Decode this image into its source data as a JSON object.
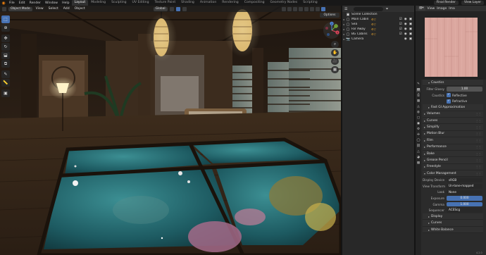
{
  "topbar": {
    "menus": [
      "File",
      "Edit",
      "Render",
      "Window",
      "Help"
    ],
    "workspaces": [
      "Layout",
      "Modeling",
      "Sculpting",
      "UV Editing",
      "Texture Paint",
      "Shading",
      "Animation",
      "Rendering",
      "Compositing",
      "Geometry Nodes",
      "Scripting"
    ],
    "active_workspace": "Layout",
    "scene": "Final Render",
    "view_layer": "View Layer"
  },
  "viewport": {
    "mode": "Object Mode",
    "menus": [
      "View",
      "Select",
      "Add",
      "Object"
    ],
    "transform_orientation": "Global",
    "options_label": "Options",
    "tools": [
      {
        "icon": "select-cursor-icon",
        "glyph": "⬚"
      },
      {
        "icon": "cursor-icon",
        "glyph": "⊕"
      },
      {
        "icon": "move-icon",
        "glyph": "✥"
      },
      {
        "icon": "rotate-icon",
        "glyph": "↻"
      },
      {
        "icon": "scale-icon",
        "glyph": "⬓"
      },
      {
        "icon": "transform-icon",
        "glyph": "⧉"
      },
      {
        "icon": "annotate-icon",
        "glyph": "✎"
      },
      {
        "icon": "measure-icon",
        "glyph": "📏"
      },
      {
        "icon": "add-cube-icon",
        "glyph": "▣"
      }
    ],
    "gizmo_axes": {
      "x": "X",
      "y": "Y",
      "z": "Z"
    },
    "nav_buttons": [
      {
        "icon": "zoom-icon",
        "glyph": "⌕"
      },
      {
        "icon": "pan-icon",
        "glyph": "✋"
      },
      {
        "icon": "camera-view-icon",
        "glyph": "🎥"
      },
      {
        "icon": "perspective-icon",
        "glyph": "▦"
      }
    ]
  },
  "outliner": {
    "root": "Scene Collection",
    "items": [
      {
        "name": "Main Cabin",
        "icon": "collection-icon"
      },
      {
        "name": "Sea",
        "icon": "collection-icon"
      },
      {
        "name": "Far Away",
        "icon": "collection-icon"
      },
      {
        "name": "BG Cabins",
        "icon": "collection-icon"
      },
      {
        "name": "Camera",
        "icon": "camera-icon"
      }
    ]
  },
  "image_editor": {
    "view": "View",
    "image": "Image",
    "menu3": "Ima"
  },
  "properties": {
    "caustics": {
      "section": "Caustics",
      "filter_glossy_label": "Filter Glossy",
      "filter_glossy_value": "1.00",
      "caustics_label": "Caustics",
      "reflective_label": "Reflective",
      "refractive_label": "Refractive"
    },
    "sections_mid": [
      "Fast GI Approximation",
      "Volumes",
      "Curves",
      "Simplify",
      "Motion Blur",
      "Film",
      "Performance",
      "Bake",
      "Grease Pencil",
      "Freestyle",
      "Color Management"
    ],
    "color_management": {
      "display_device_label": "Display Device",
      "display_device_value": "sRGB",
      "view_transform_label": "View Transform",
      "view_transform_value": "Un-tone-mapped",
      "look_label": "Look",
      "look_value": "None",
      "exposure_label": "Exposure",
      "exposure_value": "0.000",
      "gamma_label": "Gamma",
      "gamma_value": "1.000",
      "sequencer_label": "Sequencer",
      "sequencer_value": "ACEScg",
      "sub_sections": [
        "Display",
        "Curves",
        "White Balance"
      ]
    }
  },
  "status": {
    "version": "4.2.0"
  },
  "colors": {
    "accent": "#4772b3",
    "blender_orange": "#e87d0d",
    "panel": "#2b2b2b"
  }
}
